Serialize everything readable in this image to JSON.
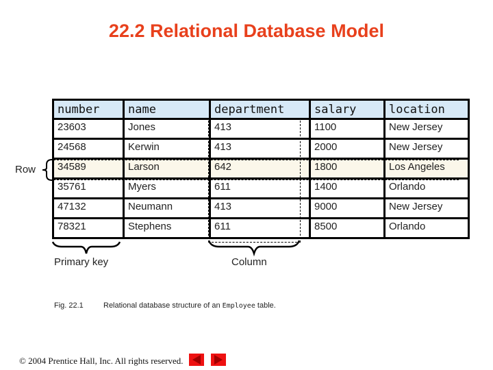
{
  "title": "22.2  Relational Database Model",
  "table": {
    "columns": [
      "number",
      "name",
      "department",
      "salary",
      "location"
    ],
    "rows": [
      [
        "23603",
        "Jones",
        "413",
        "1100",
        "New Jersey"
      ],
      [
        "24568",
        "Kerwin",
        "413",
        "2000",
        "New Jersey"
      ],
      [
        "34589",
        "Larson",
        "642",
        "1800",
        "Los Angeles"
      ],
      [
        "35761",
        "Myers",
        "611",
        "1400",
        "Orlando"
      ],
      [
        "47132",
        "Neumann",
        "413",
        "9000",
        "New Jersey"
      ],
      [
        "78321",
        "Stephens",
        "611",
        "8500",
        "Orlando"
      ]
    ],
    "highlighted_row_index": 2,
    "highlighted_column": "department"
  },
  "annotations": {
    "row_label": "Row",
    "primary_key_label": "Primary key",
    "column_label": "Column"
  },
  "caption": {
    "fig_number": "Fig. 22.1",
    "text_before": "Relational database structure of an ",
    "code": "Employee",
    "text_after": " table."
  },
  "footer": {
    "copyright": "© 2004 Prentice Hall, Inc.  All rights reserved.",
    "prev_icon": "previous-slide-icon",
    "next_icon": "next-slide-icon"
  },
  "colors": {
    "title": "#e8401c",
    "header_bg": "#d7e9f7",
    "highlight_bg": "#fbf7ea",
    "nav_button": "#ee1111"
  }
}
